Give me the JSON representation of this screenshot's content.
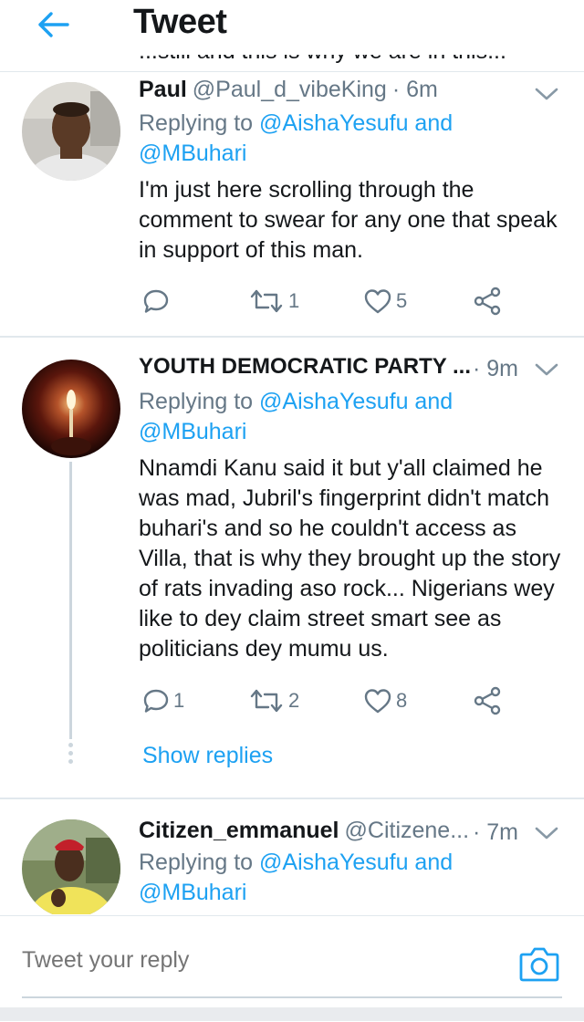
{
  "header": {
    "title": "Tweet",
    "back_icon": "arrow-left-icon"
  },
  "cutoff_text": "...still and this is why we are in this...",
  "tweets": [
    {
      "name": "Paul",
      "handle": "@Paul_d_vibeKing",
      "time": "· 6m",
      "replying_prefix": "Replying to ",
      "replying_link1": "@AishaYesufu and",
      "replying_link2": "@MBuhari",
      "text": "I'm just here scrolling through the comment to swear for any one that speak in support of this man.",
      "reply_count": "",
      "retweet_count": "1",
      "like_count": "5"
    },
    {
      "name": "YOUTH DEMOCRATIC PARTY ...",
      "handle": "",
      "time": "· 9m",
      "replying_prefix": "Replying to ",
      "replying_link1": "@AishaYesufu and",
      "replying_link2": "@MBuhari",
      "text": "Nnamdi Kanu said it but y'all claimed he was mad, Jubril's fingerprint didn't match buhari's and so he couldn't access as Villa, that is why they brought up the story of rats invading aso rock... Nigerians wey like to dey claim street smart see as politicians dey mumu us.",
      "reply_count": "1",
      "retweet_count": "2",
      "like_count": "8",
      "show_replies": "Show replies"
    },
    {
      "name": "Citizen_emmanuel",
      "handle": "@Citizene...",
      "time": "· 7m",
      "replying_prefix": "Replying to ",
      "replying_link1": "@AishaYesufu and",
      "replying_link2": "@MBuhari"
    }
  ],
  "reply_bar": {
    "placeholder": "Tweet your reply",
    "camera_icon": "camera-icon"
  },
  "colors": {
    "accent": "#1da1f2",
    "muted": "#657786",
    "text": "#14171a",
    "divider": "#e1e8ed"
  }
}
